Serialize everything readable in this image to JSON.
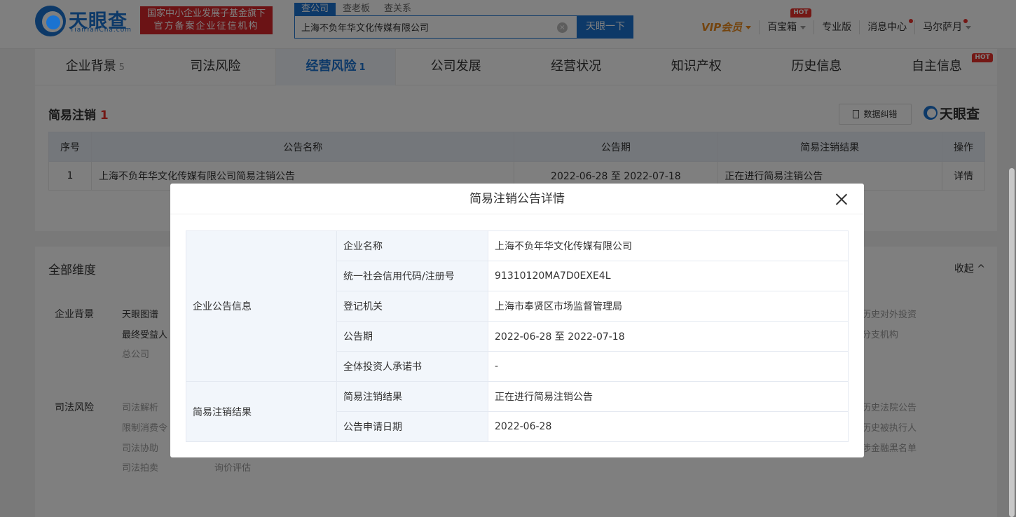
{
  "header": {
    "logo_title": "天眼查",
    "logo_sub": "TianYanCha.com",
    "badge_line1": "国家中小企业发展子基金旗下",
    "badge_line2": "官方备案企业征信机构",
    "search_tabs": [
      "查公司",
      "查老板",
      "查关系"
    ],
    "search_value": "上海不负年华文化传媒有限公司",
    "search_button": "天眼一下",
    "clear_symbol": "×",
    "nav": {
      "vip": "VIP会员",
      "toolbox": "百宝箱",
      "toolbox_badge": "HOT",
      "pro": "专业版",
      "messages": "消息中心",
      "user": "马尔萨月"
    }
  },
  "tabs": [
    {
      "label": "企业背景",
      "count": "5"
    },
    {
      "label": "司法风险",
      "count": ""
    },
    {
      "label": "经营风险",
      "count": "1"
    },
    {
      "label": "公司发展",
      "count": ""
    },
    {
      "label": "经营状况",
      "count": ""
    },
    {
      "label": "知识产权",
      "count": ""
    },
    {
      "label": "历史信息",
      "count": ""
    },
    {
      "label": "自主信息",
      "count": "",
      "badge": "HOT"
    }
  ],
  "section": {
    "title": "简易注销",
    "count": "1",
    "feedback": "数据纠错",
    "brand": "天眼查"
  },
  "list_table": {
    "headers": [
      "序号",
      "公告名称",
      "公告期",
      "简易注销结果",
      "操作"
    ],
    "rows": [
      {
        "no": "1",
        "name": "上海不负年华文化传媒有限公司简易注销公告",
        "period": "2022-06-28 至 2022-07-18",
        "result": "正在进行简易注销公告",
        "action": "详情"
      }
    ]
  },
  "dimensions": {
    "title": "全部维度",
    "collapse": "收起",
    "groups": [
      {
        "label": "企业背景",
        "items": [
          "天眼图谱",
          "最终受益人",
          "总公司"
        ],
        "right_items": [
          "历史对外投资",
          "分支机构"
        ]
      },
      {
        "label": "司法风险",
        "items": [
          "司法解析",
          "限制消费令",
          "司法协助",
          "司法拍卖"
        ],
        "extra": "询价评估",
        "right_items": [
          "历史法院公告",
          "历史被执行人",
          "涉金融黑名单"
        ]
      }
    ]
  },
  "modal": {
    "title": "简易注销公告详情",
    "groups": [
      {
        "name": "企业公告信息",
        "rows": [
          {
            "label": "企业名称",
            "value": "上海不负年华文化传媒有限公司"
          },
          {
            "label": "统一社会信用代码/注册号",
            "value": "91310120MA7D0EXE4L"
          },
          {
            "label": "登记机关",
            "value": "上海市奉贤区市场监督管理局"
          },
          {
            "label": "公告期",
            "value": "2022-06-28 至 2022-07-18"
          },
          {
            "label": "全体投资人承诺书",
            "value": "-"
          }
        ]
      },
      {
        "name": "简易注销结果",
        "rows": [
          {
            "label": "简易注销结果",
            "value": "正在进行简易注销公告"
          },
          {
            "label": "公告申请日期",
            "value": "2022-06-28"
          }
        ]
      }
    ]
  },
  "colors": {
    "brand_blue": "#1a73d1",
    "hot_red": "#e8302a",
    "vip_orange": "#e8891c"
  }
}
